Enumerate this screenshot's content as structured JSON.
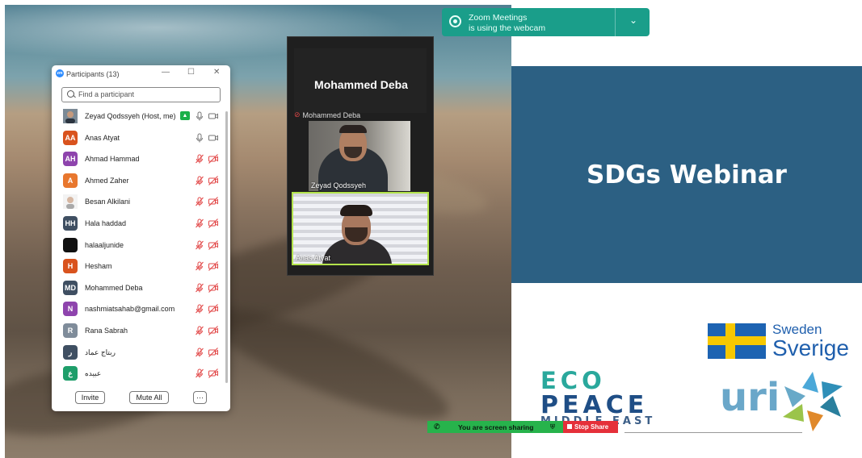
{
  "notification": {
    "line1": "Zoom Meetings",
    "line2": "is using the webcam"
  },
  "gallery": {
    "active_speaker": "Mohammed Deba",
    "active_speaker_label": "Mohammed Deba",
    "tiles": [
      {
        "label": "Zeyad Qodssyeh"
      },
      {
        "label": "Anas Atyat"
      }
    ]
  },
  "participants": {
    "title": "Participants (13)",
    "search_placeholder": "Find a participant",
    "rows": [
      {
        "name": "Zeyad Qodssyeh (Host, me)",
        "avatar": "",
        "avatar_color": "#6c7a89",
        "mic": "on",
        "video": "off",
        "sharing": true
      },
      {
        "name": "Anas Atyat",
        "avatar": "AA",
        "avatar_color": "#d9531e",
        "mic": "on",
        "video": "off"
      },
      {
        "name": "Ahmad Hammad",
        "avatar": "AH",
        "avatar_color": "#8e44ad",
        "mic": "muted",
        "video": "muted"
      },
      {
        "name": "Ahmed Zaher",
        "avatar": "A",
        "avatar_color": "#e8772e",
        "mic": "muted",
        "video": "muted"
      },
      {
        "name": "Besan Alkilani",
        "avatar": "",
        "avatar_color": "#e9e9e9",
        "mic": "muted",
        "video": "muted"
      },
      {
        "name": "Hala haddad",
        "avatar": "HH",
        "avatar_color": "#3f4f62",
        "mic": "muted",
        "video": "muted"
      },
      {
        "name": "halaaljunide",
        "avatar": "",
        "avatar_color": "#111111",
        "mic": "muted",
        "video": "muted"
      },
      {
        "name": "Hesham",
        "avatar": "H",
        "avatar_color": "#d9531e",
        "mic": "muted",
        "video": "muted"
      },
      {
        "name": "Mohammed Deba",
        "avatar": "MD",
        "avatar_color": "#3f4f62",
        "mic": "muted",
        "video": "muted"
      },
      {
        "name": "nashmiatsahab@gmail.com",
        "avatar": "N",
        "avatar_color": "#8e44ad",
        "mic": "muted",
        "video": "muted"
      },
      {
        "name": "Rana Sabrah",
        "avatar": "R",
        "avatar_color": "#7f8c9a",
        "mic": "muted",
        "video": "muted"
      },
      {
        "name": "ربتاج عماد",
        "avatar": "ر",
        "avatar_color": "#3f4f62",
        "mic": "muted",
        "video": "muted"
      },
      {
        "name": "عبيده",
        "avatar": "ع",
        "avatar_color": "#1e9e6a",
        "mic": "muted",
        "video": "muted"
      }
    ],
    "invite_label": "Invite",
    "mute_all_label": "Mute All",
    "more_label": "···"
  },
  "slide": {
    "title": "SDGs Webinar",
    "sweden_line1": "Sweden",
    "sweden_line2": "Sverige",
    "eco_line1": "ECO",
    "eco_line2": "PEACE",
    "eco_line3": "MIDDLE EAST",
    "uri_text": "uri",
    "brand_blue": "#2c6083"
  },
  "share_bar": {
    "status": "You are screen sharing",
    "stop_label": "Stop Share"
  }
}
